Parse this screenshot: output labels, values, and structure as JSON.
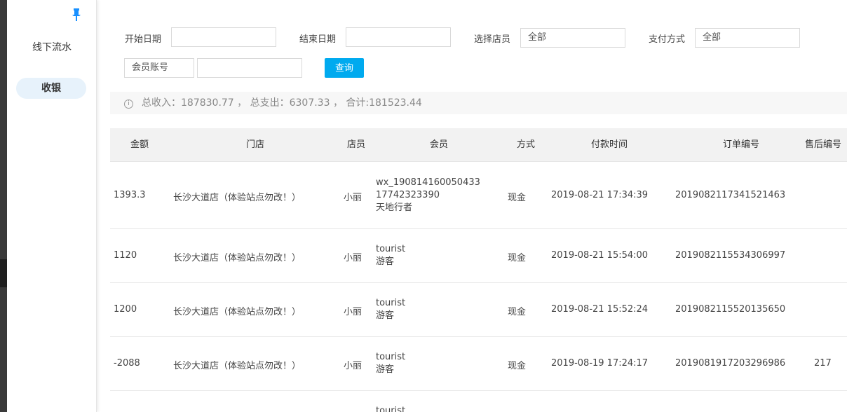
{
  "sidebar": {
    "pin_icon": "pin-icon",
    "items": [
      {
        "label": "线下流水"
      },
      {
        "label": "收银"
      }
    ]
  },
  "filters": {
    "start_date_label": "开始日期",
    "start_date_value": "",
    "end_date_label": "结束日期",
    "end_date_value": "",
    "store_label": "选择店员",
    "store_value": "全部",
    "payment_label": "支付方式",
    "payment_value": "全部",
    "member_select_value": "会员账号",
    "member_input_value": "",
    "query_button": "查询"
  },
  "summary": {
    "icon": "info-icon",
    "text": "总收入：187830.77 ， 总支出：6307.33 ， 合计:181523.44"
  },
  "table": {
    "headers": [
      "金额",
      "门店",
      "店员",
      "会员",
      "方式",
      "付款时间",
      "订单编号",
      "售后编号"
    ],
    "rows": [
      {
        "amount": "1393.3",
        "store": "长沙大道店（体验站点勿改！）",
        "clerk": "小丽",
        "member": [
          "wx_190814160050433",
          "17742323390",
          "天地行者"
        ],
        "method": "现金",
        "time": "2019-08-21 17:34:39",
        "order": "2019082117341521463",
        "after_sale": ""
      },
      {
        "amount": "1120",
        "store": "长沙大道店（体验站点勿改！）",
        "clerk": "小丽",
        "member": [
          "tourist",
          "游客"
        ],
        "method": "现金",
        "time": "2019-08-21 15:54:00",
        "order": "2019082115534306997",
        "after_sale": ""
      },
      {
        "amount": "1200",
        "store": "长沙大道店（体验站点勿改！）",
        "clerk": "小丽",
        "member": [
          "tourist",
          "游客"
        ],
        "method": "现金",
        "time": "2019-08-21 15:52:24",
        "order": "2019082115520135650",
        "after_sale": ""
      },
      {
        "amount": "-2088",
        "store": "长沙大道店（体验站点勿改！）",
        "clerk": "小丽",
        "member": [
          "tourist",
          "游客"
        ],
        "method": "现金",
        "time": "2019-08-19 17:24:17",
        "order": "2019081917203296986",
        "after_sale": "217"
      },
      {
        "amount": "",
        "store": "",
        "clerk": "",
        "member": [
          "tourist"
        ],
        "method": "",
        "time": "",
        "order": "",
        "after_sale": ""
      }
    ]
  }
}
